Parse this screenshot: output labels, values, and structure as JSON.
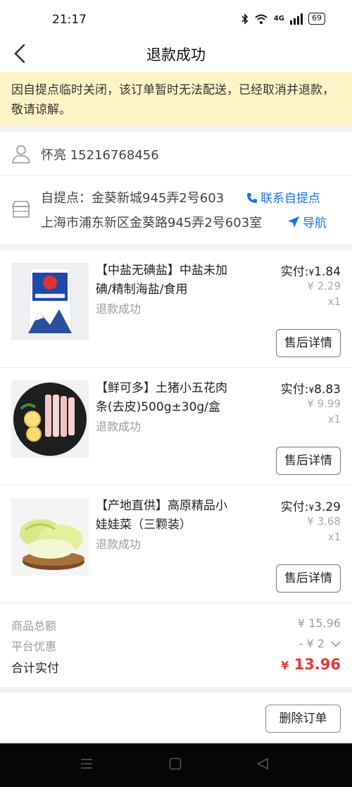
{
  "status_bar": {
    "time": "21:17",
    "network": "4G",
    "battery": "69"
  },
  "header": {
    "title": "退款成功"
  },
  "notice": {
    "text": "因自提点临时关闭，该订单暂时无法配送，已经取消并退款，敬请谅解。"
  },
  "contact": {
    "name_phone": "怀亮  15216768456"
  },
  "pickup": {
    "label": "自提点：金葵新城945弄2号603",
    "address": "上海市浦东新区金葵路945弄2号603室",
    "contact_link": "联系自提点",
    "nav_link": "导航"
  },
  "products": [
    {
      "name": "【中盐无碘盐】中盐未加碘/精制海盐/食用",
      "status": "退款成功",
      "paid_label": "实付:",
      "currency": "¥",
      "paid": "1.84",
      "original": "¥ 2.29",
      "qty": "x1",
      "action": "售后详情"
    },
    {
      "name": "【鲜可多】土猪小五花肉条(去皮)500g±30g/盒",
      "status": "退款成功",
      "paid_label": "实付:",
      "currency": "¥",
      "paid": "8.83",
      "original": "¥ 9.99",
      "qty": "x1",
      "action": "售后详情"
    },
    {
      "name": "【产地直供】高原精品小娃娃菜（三颗装）",
      "status": "退款成功",
      "paid_label": "实付:",
      "currency": "¥",
      "paid": "3.29",
      "original": "¥ 3.68",
      "qty": "x1",
      "action": "售后详情"
    }
  ],
  "summary": {
    "goods_label": "商品总额",
    "goods_value": "¥ 15.96",
    "discount_label": "平台优惠",
    "discount_value": "- ¥ 2",
    "total_label": "合计实付",
    "total_currency": "¥",
    "total_value": "13.96"
  },
  "footer": {
    "delete_label": "删除订单"
  },
  "colors": {
    "accent_red": "#e53935",
    "link_blue": "#1a73e8",
    "notice_bg": "#fdf4c6"
  }
}
